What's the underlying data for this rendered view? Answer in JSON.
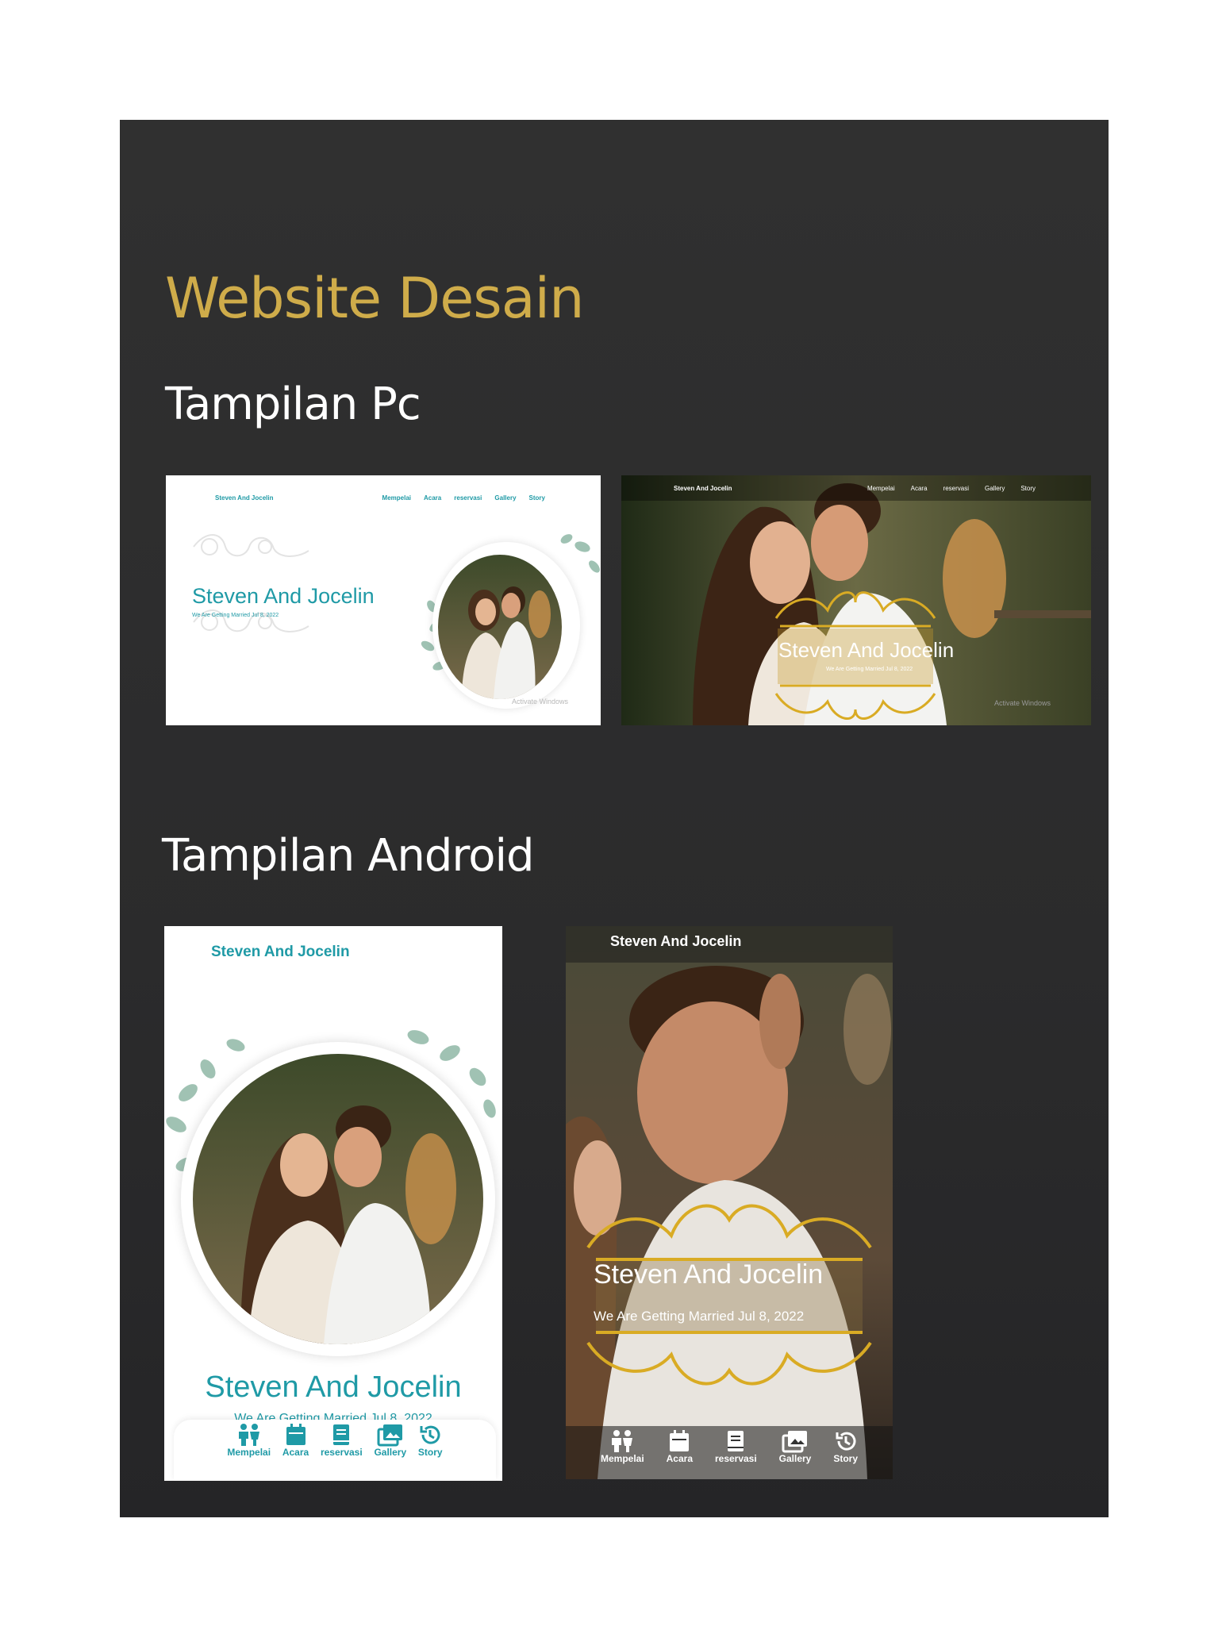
{
  "heading": "Website Desain",
  "sections": {
    "pc": "Tampilan Pc",
    "android": "Tampilan Android"
  },
  "couple_name": "Steven And Jocelin",
  "tagline": "We Are Getting Married Jul 8, 2022",
  "nav": [
    "Mempelai",
    "Acara",
    "reservasi",
    "Gallery",
    "Story"
  ],
  "watermark": "Activate Windows",
  "colors": {
    "heading_gold": "#cfac4a",
    "teal": "#1f9aa6",
    "panel": "#2e2e2f",
    "ornament_gold": "#d9ab24"
  },
  "icons": [
    "couple-icon",
    "calendar-icon",
    "book-icon",
    "gallery-icon",
    "history-icon"
  ]
}
